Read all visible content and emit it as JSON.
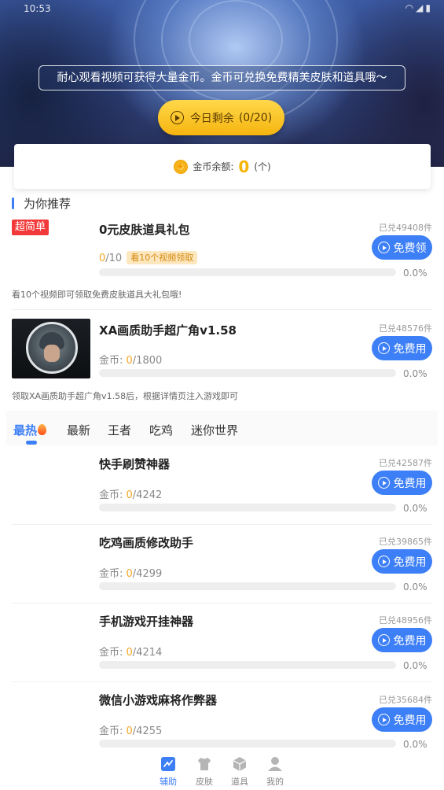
{
  "status": {
    "time": "10:53"
  },
  "banner": {
    "notice": "耐心观看视频可获得大量金币。金币可兑换免费精美皮肤和道具哦～",
    "remain_prefix": "今日剩余",
    "remain_value": "(0/20)"
  },
  "balance": {
    "label": "金币余额:",
    "value": "0",
    "unit": "(个)"
  },
  "section": {
    "title": "为你推荐"
  },
  "featured": [
    {
      "badge": "超简单",
      "title": "0元皮肤道具礼包",
      "progress_current": "0",
      "progress_total": "/10",
      "tag": "看10个视频领取",
      "redeemed": "已兑49408件",
      "button": "免费领",
      "percent": "0.0%",
      "progress_fraction": 0,
      "description": "看10个视频即可领取免费皮肤道具大礼包哦!"
    },
    {
      "title": "XA画质助手超广角v1.58",
      "coin_label": "金币: ",
      "coin_current": "0",
      "coin_total": "/1800",
      "redeemed": "已兑48576件",
      "button": "免费用",
      "percent": "0.0%",
      "progress_fraction": 0,
      "description": "领取XA画质助手超广角v1.58后，根据详情页注入游戏即可"
    }
  ],
  "tabs": [
    "最热",
    "最新",
    "王者",
    "吃鸡",
    "迷你世界"
  ],
  "list": [
    {
      "title": "快手刷赞神器",
      "coin_label": "金币: ",
      "coin_current": "0",
      "coin_total": "/4242",
      "redeemed": "已兑42587件",
      "button": "免费用",
      "percent": "0.0%",
      "progress_fraction": 0
    },
    {
      "title": "吃鸡画质修改助手",
      "coin_label": "金币: ",
      "coin_current": "0",
      "coin_total": "/4299",
      "redeemed": "已兑39865件",
      "button": "免费用",
      "percent": "0.0%",
      "progress_fraction": 0
    },
    {
      "title": "手机游戏开挂神器",
      "coin_label": "金币: ",
      "coin_current": "0",
      "coin_total": "/4214",
      "redeemed": "已兑48956件",
      "button": "免费用",
      "percent": "0.0%",
      "progress_fraction": 0
    },
    {
      "title": "微信小游戏麻将作弊器",
      "coin_label": "金币: ",
      "coin_current": "0",
      "coin_total": "/4255",
      "redeemed": "已兑35684件",
      "button": "免费用",
      "percent": "0.0%",
      "progress_fraction": 0
    }
  ],
  "bottom_nav": [
    {
      "label": "辅助",
      "icon": "assist-icon",
      "active": true
    },
    {
      "label": "皮肤",
      "icon": "shirt-icon",
      "active": false
    },
    {
      "label": "道具",
      "icon": "box-icon",
      "active": false
    },
    {
      "label": "我的",
      "icon": "user-icon",
      "active": false
    }
  ],
  "colors": {
    "accent": "#3d7ff6",
    "coin": "#f5b50a",
    "badge": "#f23a3a",
    "gold_button": "#f6b40f"
  }
}
